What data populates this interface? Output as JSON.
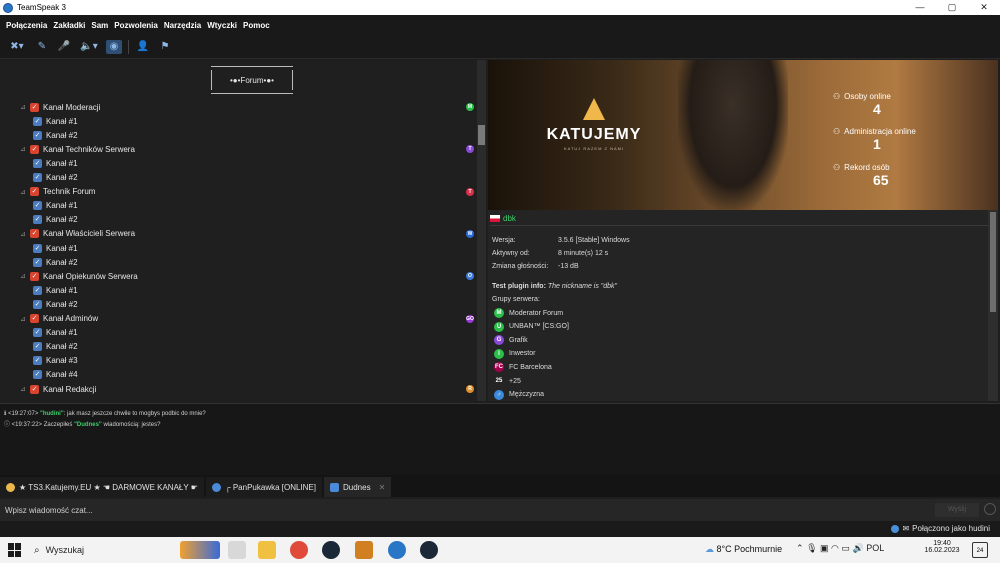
{
  "window": {
    "title": "TeamSpeak 3",
    "controls": [
      "—",
      "▢",
      "✕"
    ]
  },
  "menu": [
    "Połączenia",
    "Zakładki",
    "Sam",
    "Pozwolenia",
    "Narzędzia",
    "Wtyczki",
    "Pomoc"
  ],
  "toolbar_icons": [
    "disconnect-icon",
    "bookmark-icon",
    "mute-mic-icon",
    "mute-speaker-icon",
    "away-icon",
    "identity-icon",
    "subscribe-icon"
  ],
  "tree": {
    "spacer": "•●•Forum•●•",
    "rows": [
      {
        "label": "Kanał Moderacji",
        "level": 1,
        "badge": "M",
        "badge_color": "#2bbf4a"
      },
      {
        "label": "Kanał #1",
        "level": 2
      },
      {
        "label": "Kanał #2",
        "level": 2
      },
      {
        "label": "Kanał Techników Serwera",
        "level": 1,
        "badge": "T",
        "badge_color": "#8a4ad9"
      },
      {
        "label": "Kanał #1",
        "level": 2
      },
      {
        "label": "Kanał #2",
        "level": 2
      },
      {
        "label": "Technik Forum",
        "level": 1,
        "badge": "T",
        "badge_color": "#d9304a"
      },
      {
        "label": "Kanał #1",
        "level": 2
      },
      {
        "label": "Kanał #2",
        "level": 2
      },
      {
        "label": "Kanał Właścicieli Serwera",
        "level": 1,
        "badge": "W",
        "badge_color": "#2a6ad9"
      },
      {
        "label": "Kanał #1",
        "level": 2
      },
      {
        "label": "Kanał #2",
        "level": 2
      },
      {
        "label": "Kanał Opiekunów Serwera",
        "level": 1,
        "badge": "O",
        "badge_color": "#3a7ad9"
      },
      {
        "label": "Kanał #1",
        "level": 2
      },
      {
        "label": "Kanał #2",
        "level": 2
      },
      {
        "label": "Kanał Adminów",
        "level": 1,
        "badge": "GO",
        "badge_color": "#9a3ad9"
      },
      {
        "label": "Kanał #1",
        "level": 2
      },
      {
        "label": "Kanał #2",
        "level": 2
      },
      {
        "label": "Kanał #3",
        "level": 2
      },
      {
        "label": "Kanał #4",
        "level": 2
      },
      {
        "label": "Kanał Redakcji",
        "level": 1,
        "badge": "R",
        "badge_color": "#e0902a"
      }
    ]
  },
  "banner": {
    "brand": "KATUJEMY",
    "tagline": "KATUJ RAZEM Z NAMI",
    "stats": [
      {
        "label": "Osoby online",
        "value": "4"
      },
      {
        "label": "Administracja online",
        "value": "1"
      },
      {
        "label": "Rekord osób",
        "value": "65"
      }
    ]
  },
  "client": {
    "nickname": "dbk",
    "fields": [
      {
        "key": "Wersja:",
        "value": "3.5.6 [Stable] Windows"
      },
      {
        "key": "Aktywny od:",
        "value": "8 minute(s) 12 s"
      },
      {
        "key": "Zmiana głośności:",
        "value": "-13 dB"
      }
    ],
    "plugin_label": "Test plugin info:",
    "plugin_value": "The nickname is \"dbk\"",
    "groups_label": "Grupy serwera:",
    "groups": [
      {
        "name": "Moderator Forum",
        "icon": "M",
        "color": "#2bbf4a"
      },
      {
        "name": "UNBAN™ [CS:GO]",
        "icon": "U",
        "color": "#2bbf4a"
      },
      {
        "name": "Grafik",
        "icon": "G",
        "color": "#8a4ad9"
      },
      {
        "name": "Inwestor",
        "icon": "I",
        "color": "#2bbf4a"
      },
      {
        "name": "FC Barcelona",
        "icon": "FC",
        "color": "#a5004d"
      },
      {
        "name": "+25",
        "icon": "25",
        "color": "#242424"
      },
      {
        "name": "Mężczyzna",
        "icon": "♂",
        "color": "#3a8ad9"
      }
    ]
  },
  "log": [
    {
      "time": "<19:27:07>",
      "nick": "\"hudini\"",
      "text": ": jak masz jeszcze chwile to mogbys podbic do mnie?"
    },
    {
      "time": "<19:37:22>",
      "pre": "Zaczepiłeś ",
      "nick": "\"Dudnes\"",
      "text": " wiadomością: jestes?"
    }
  ],
  "tabs": [
    {
      "label": "★ TS3.Katujemy.EU ★ ☚ DARMOWE KANAŁY ☛",
      "color": "#e8b84a"
    },
    {
      "label": "┌ PanPukawka [ONLINE]",
      "color": "#4a8ad9"
    },
    {
      "label": "Dudnes",
      "color": "#4a8ad9",
      "close": "✕"
    }
  ],
  "chat": {
    "placeholder": "Wpisz wiadomość czat...",
    "send": "Wyślij"
  },
  "status": {
    "text": "Połączono jako hudini"
  },
  "taskbar": {
    "search": "Wyszukaj",
    "weather": "8°C  Pochmurnie",
    "lang": "POL",
    "time": "19:40",
    "date": "16.02.2023",
    "notifications": "24"
  }
}
